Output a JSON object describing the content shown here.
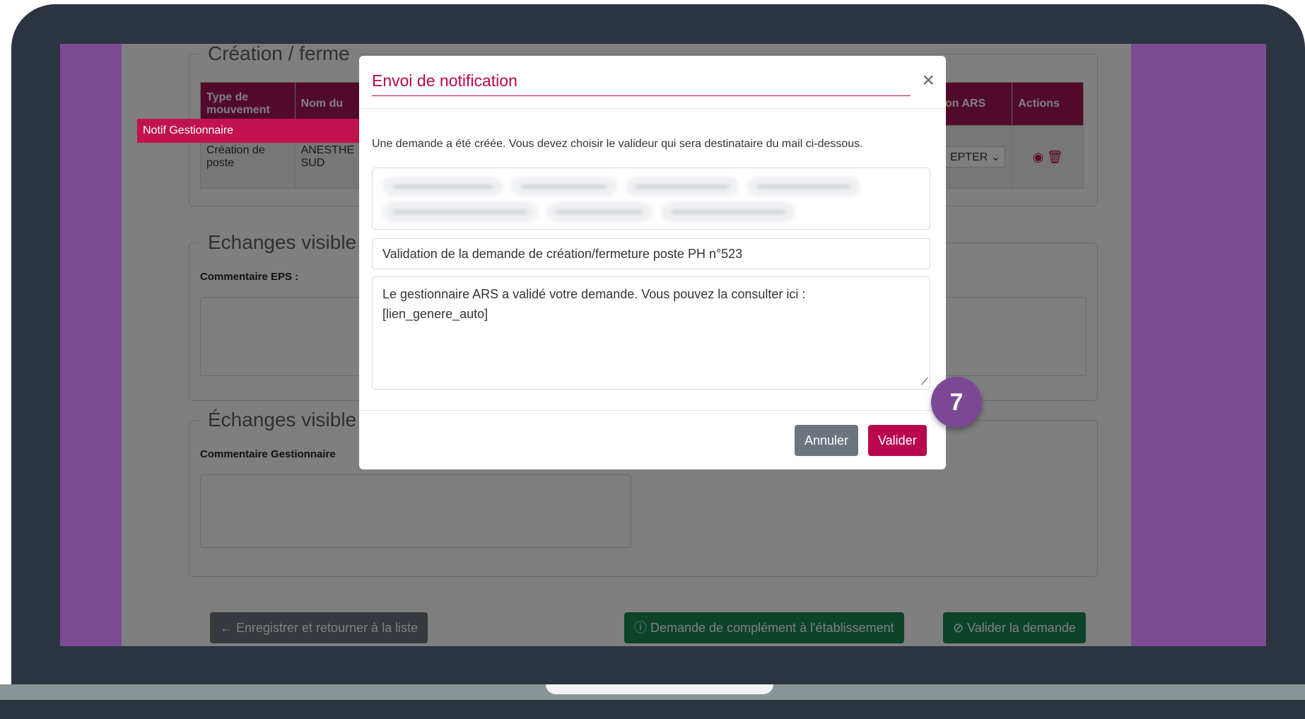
{
  "section_creation": {
    "legend": "Création / ferme"
  },
  "table": {
    "headers": {
      "type_mouvement": "Type de mouvement",
      "nom": "Nom du",
      "decision": "on ARS",
      "actions": "Actions"
    },
    "row": {
      "type_mouvement": "Création de poste",
      "nom": "ANESTHE SUD",
      "decision_select": "EPTER"
    }
  },
  "badge": {
    "notif_gestionnaire": "Notif Gestionnaire"
  },
  "section_echanges_eps": {
    "legend": "Echanges visible",
    "comment_label": "Commentaire EPS :"
  },
  "section_echanges_gest": {
    "legend": "Échanges visible",
    "comment_label": "Commentaire Gestionnaire"
  },
  "footer_buttons": {
    "back": "← Enregistrer et retourner à la liste",
    "complement": "ⓘ Demande de complément à l'établissement",
    "validate_request": "⊘ Valider la demande"
  },
  "modal": {
    "title": "Envoi de notification",
    "close": "×",
    "intro": "Une demande a été créée. Vous devez choisir le valideur qui sera destinataire du mail ci-dessous.",
    "subject": "Validation de la demande de création/fermeture poste PH n°523",
    "body_line1": "Le gestionnaire ARS a validé votre demande. Vous pouvez la consulter ici :",
    "body_line2": "[lien_genere_auto]",
    "cancel": "Annuler",
    "submit": "Valider"
  },
  "step_marker": "7",
  "colors": {
    "accent": "#b8074d",
    "screen_purple": "#7d4b95",
    "laptop_frame": "#2b3440",
    "success_green": "#198754"
  }
}
